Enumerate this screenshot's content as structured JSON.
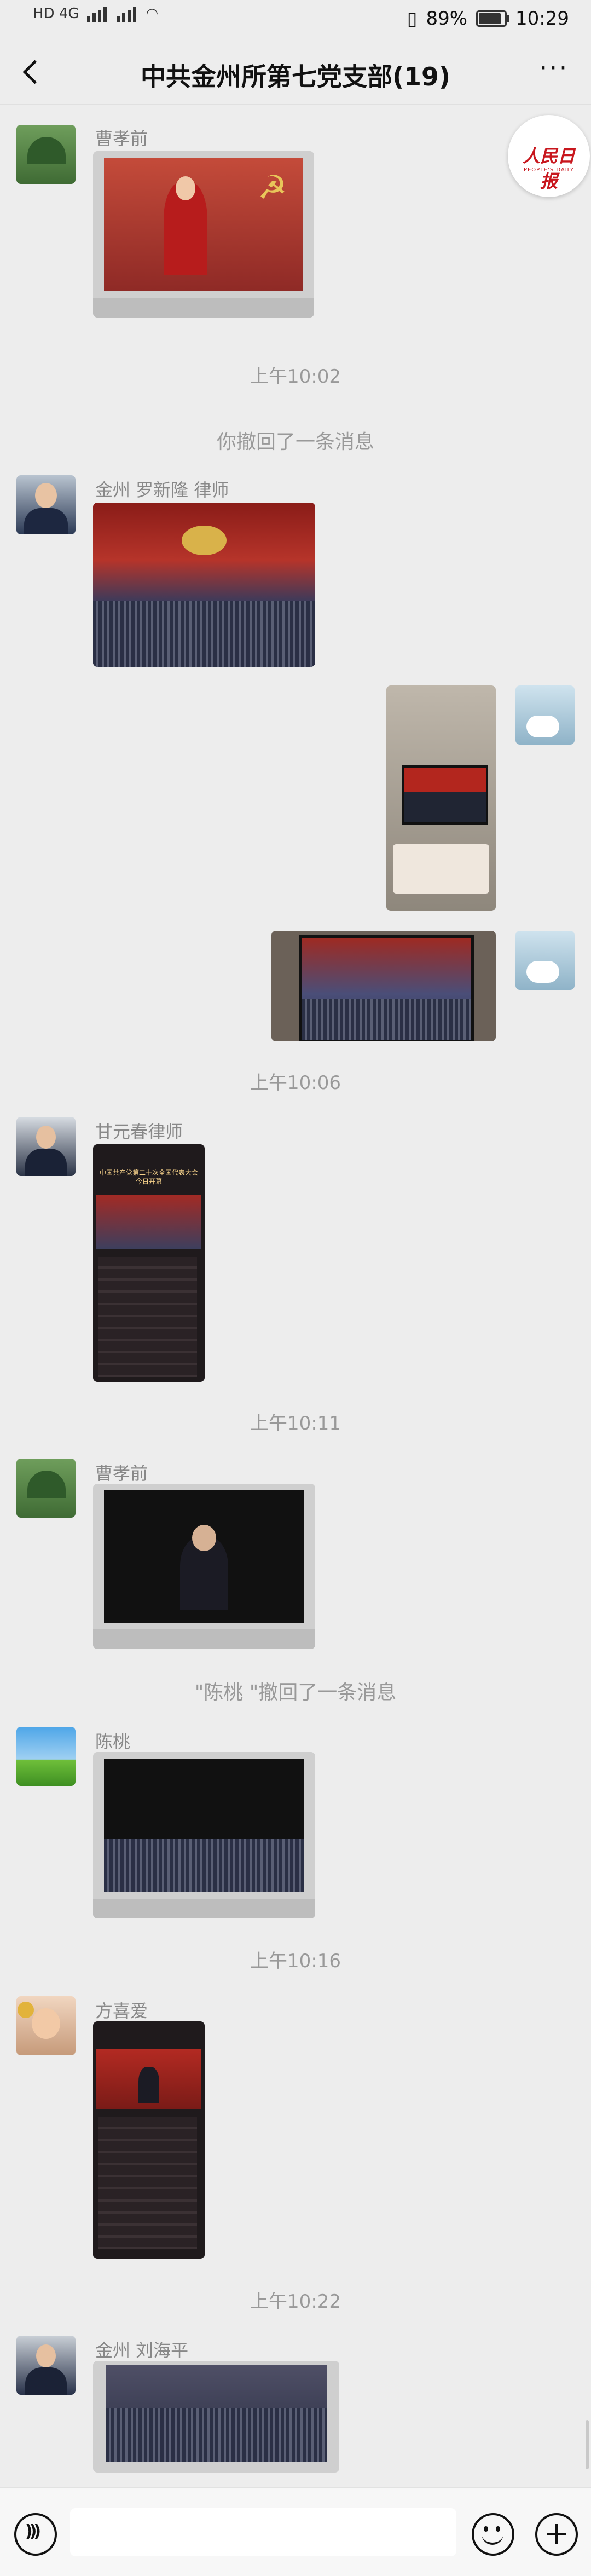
{
  "status_bar": {
    "network_left": "HD 4G",
    "battery": "89%",
    "time": "10:29"
  },
  "header": {
    "title": "中共金州所第七党支部(19)"
  },
  "logo": {
    "cn": "人民日报",
    "en": "PEOPLE'S DAILY"
  },
  "messages": {
    "m1": {
      "sender": "曹孝前"
    },
    "t1": "上午10:02",
    "n1": "你撤回了一条消息",
    "m2": {
      "sender": "金州 罗新隆 律师"
    },
    "t2": "上午10:06",
    "m5": {
      "sender": "甘元春律师",
      "banner": "中国共产党第二十次全国代表大会 今日开幕"
    },
    "t3": "上午10:11",
    "m6": {
      "sender": "曹孝前"
    },
    "n2": "\"陈桃  \"撤回了一条消息",
    "m7": {
      "sender": "陈桃"
    },
    "t4": "上午10:16",
    "m8": {
      "sender": "方喜爱"
    },
    "t5": "上午10:22",
    "m9": {
      "sender": "金州 刘海平"
    }
  },
  "colors": {
    "background": "#ededed",
    "accent": "#c8161d"
  }
}
